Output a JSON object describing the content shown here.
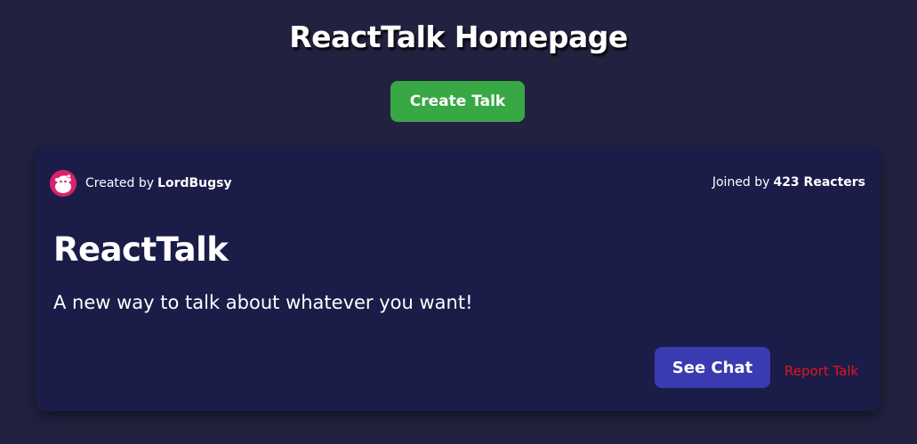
{
  "header": {
    "title": "ReactTalk Homepage",
    "create_button_label": "Create Talk"
  },
  "talk": {
    "created_by_prefix": "Created by",
    "creator_name": "LordBugsy",
    "joined_prefix": "Joined by",
    "joined_count": "423 Reacters",
    "name": "ReactTalk",
    "description": "A new way to talk about whatever you want!",
    "see_chat_label": "See Chat",
    "report_label": "Report Talk",
    "avatar_icon": "reddit-snoo-icon"
  },
  "colors": {
    "background": "#222240",
    "card": "#1b1c48",
    "create_button": "#37a843",
    "see_chat_button": "#3a3bb0",
    "report_link": "#e0151f",
    "avatar": "#d9236b"
  }
}
